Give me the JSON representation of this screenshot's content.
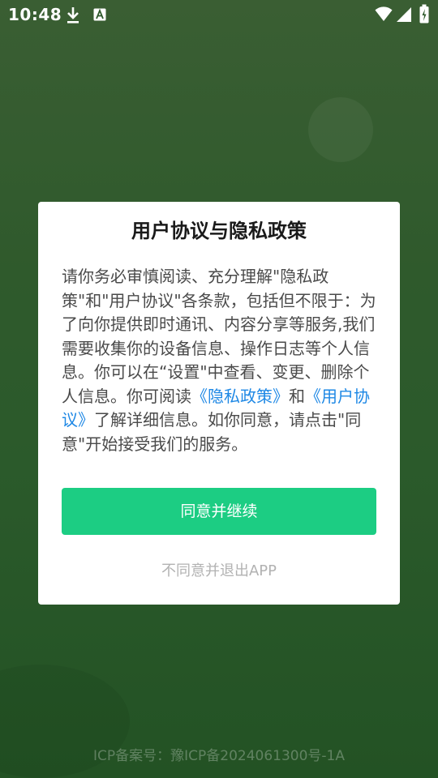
{
  "status_bar": {
    "time": "10:48",
    "icons": [
      "download-icon",
      "font-a-icon",
      "wifi-icon",
      "cellular-icon",
      "battery-icon"
    ]
  },
  "dialog": {
    "title": "用户协议与隐私政策",
    "body": {
      "part1": "请你务必审慎阅读、充分理解\"隐私政策\"和\"用户协议\"各条款，包括但不限于：为了向你提供即时通讯、内容分享等服务,我们需要收集你的设备信息、操作日志等个人信息。你可以在“设置\"中查看、变更、删除个人信息。你可阅读",
      "privacy_link": "《隐私政策》",
      "and": "和",
      "user_agreement_link": "《用户协议》",
      "part2": "了解详细信息。如你同意，请点击\"同意\"开始接受我们的服务。"
    },
    "agree_button": "同意并继续",
    "disagree_button": "不同意并退出APP"
  },
  "footer": {
    "icp": "ICP备案号：豫ICP备2024061300号-1A"
  },
  "colors": {
    "accent_button": "#1ccd83",
    "link": "#1e88e5",
    "background": "#2f5a2c"
  }
}
